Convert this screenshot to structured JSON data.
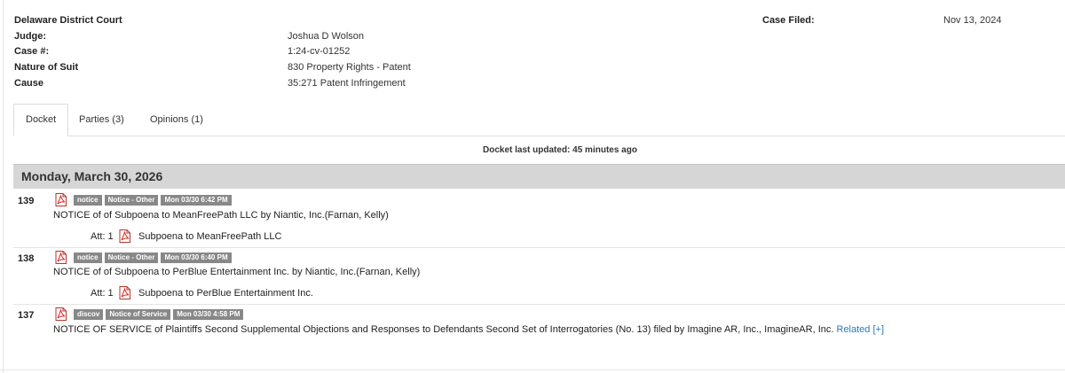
{
  "case": {
    "court": "Delaware District Court",
    "judge_label": "Judge:",
    "judge": "Joshua D Wolson",
    "case_no_label": "Case #:",
    "case_no": "1:24-cv-01252",
    "nature_label": "Nature of Suit",
    "nature": "830 Property Rights - Patent",
    "cause_label": "Cause",
    "cause": "35:271 Patent Infringement",
    "filed_label": "Case Filed:",
    "filed": "Nov 13, 2024"
  },
  "tabs": [
    {
      "label": "Docket",
      "active": true
    },
    {
      "label": "Parties (3)",
      "active": false
    },
    {
      "label": "Opinions (1)",
      "active": false
    }
  ],
  "docket_updated": "Docket last updated: 45 minutes ago",
  "day_header": "Monday, March 30, 2026",
  "entries": [
    {
      "number": "139",
      "tags": [
        "notice",
        "Notice - Other",
        "Mon 03/30 6:42 PM"
      ],
      "text": "NOTICE of of Subpoena to MeanFreePath LLC by Niantic, Inc.(Farnan, Kelly)",
      "att_label": "Att: 1",
      "att_text": "Subpoena to MeanFreePath LLC"
    },
    {
      "number": "138",
      "tags": [
        "notice",
        "Notice - Other",
        "Mon 03/30 6:40 PM"
      ],
      "text": "NOTICE of of Subpoena to PerBlue Entertainment Inc. by Niantic, Inc.(Farnan, Kelly)",
      "att_label": "Att: 1",
      "att_text": "Subpoena to PerBlue Entertainment Inc."
    },
    {
      "number": "137",
      "tags": [
        "discov",
        "Notice of Service",
        "Mon 03/30 4:58 PM"
      ],
      "text": "NOTICE OF SERVICE of Plaintiffs Second Supplemental Objections and Responses to Defendants Second Set of Interrogatories (No. 13) filed by Imagine AR, Inc., ImagineAR, Inc.",
      "related": "Related [+]"
    }
  ],
  "icons": {
    "document": "pdf-icon",
    "attachment": "pdf-icon"
  },
  "colors": {
    "tag_bg": "#888888",
    "day_header_bg": "#d6d6d6",
    "link": "#2a7ab8",
    "pdf_red": "#d9251d"
  }
}
